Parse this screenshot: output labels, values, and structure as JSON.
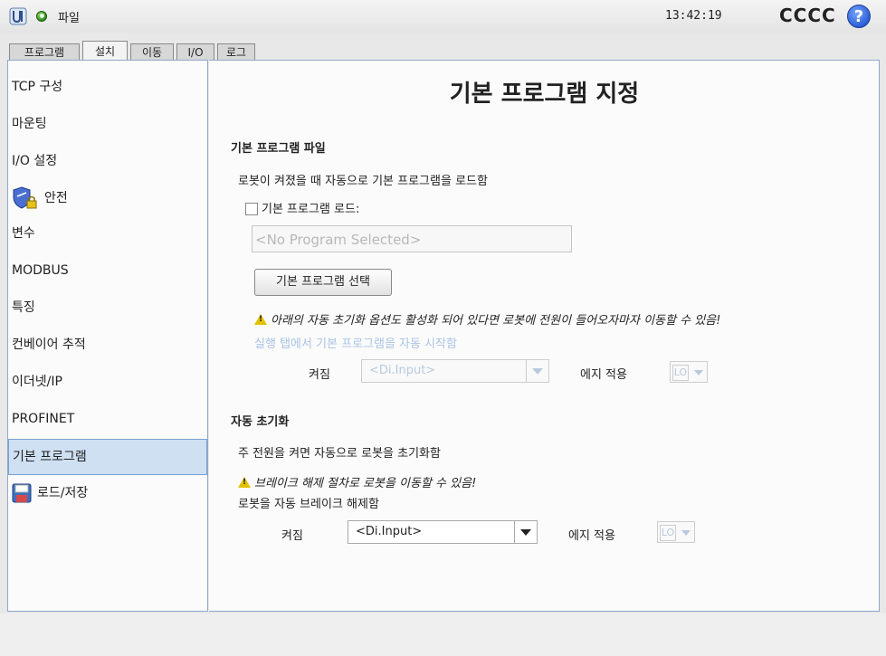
{
  "header": {
    "file_menu": "파일",
    "time": "13:42:19",
    "robot_name": "CCCC",
    "help_symbol": "?"
  },
  "tabs": [
    {
      "label": "프로그램",
      "active": false
    },
    {
      "label": "설치",
      "active": true
    },
    {
      "label": "이동",
      "active": false
    },
    {
      "label": "I/O",
      "active": false
    },
    {
      "label": "로그",
      "active": false
    }
  ],
  "sidebar": {
    "items": [
      {
        "label": "TCP 구성"
      },
      {
        "label": "마운팅"
      },
      {
        "label": "I/O 설정"
      },
      {
        "label": "안전",
        "icon": "shield-lock-icon"
      },
      {
        "label": "변수"
      },
      {
        "label": "MODBUS"
      },
      {
        "label": "특징"
      },
      {
        "label": "컨베이어 추적"
      },
      {
        "label": "이더넷/IP"
      },
      {
        "label": "PROFINET"
      },
      {
        "label": "기본 프로그램",
        "selected": true
      },
      {
        "label": "로드/저장",
        "icon": "floppy-disk-icon"
      }
    ]
  },
  "main": {
    "title": "기본 프로그램 지정",
    "default_program": {
      "heading": "기본 프로그램 파일",
      "description": "로봇이 켜졌을 때 자동으로 기본 프로그램을 로드함",
      "load_checkbox_label": "기본 프로그램 로드:",
      "load_checked": false,
      "program_field_value": "<No Program Selected>",
      "select_button": "기본 프로그램 선택",
      "warning": "아래의 자동 초기화 옵션도 활성화 되어 있다면 로봇에 전원이 들어오자마자 이동할 수 있음!",
      "autostart_label": "실행 탭에서 기본 프로그램을 자동 시작함",
      "on_label": "켜짐",
      "input_select": "<Di.Input>",
      "edge_label": "에지 적용",
      "edge_value": "LO"
    },
    "auto_init": {
      "heading": "자동 초기화",
      "description": "주 전원을 켜면 자동으로 로봇을 초기화함",
      "warning": "브레이크 해제 절차로 로봇을 이동할 수 있음!",
      "brake_label": "로봇을 자동 브레이크 해제함",
      "on_label": "켜짐",
      "input_select": "<Di.Input>",
      "edge_label": "에지 적용",
      "edge_value": "LO"
    }
  },
  "colors": {
    "accent": "#7aa2d2",
    "selected_bg": "#cfe0f3",
    "warning": "#e2c200",
    "disabled_text": "#a9c3e3"
  }
}
